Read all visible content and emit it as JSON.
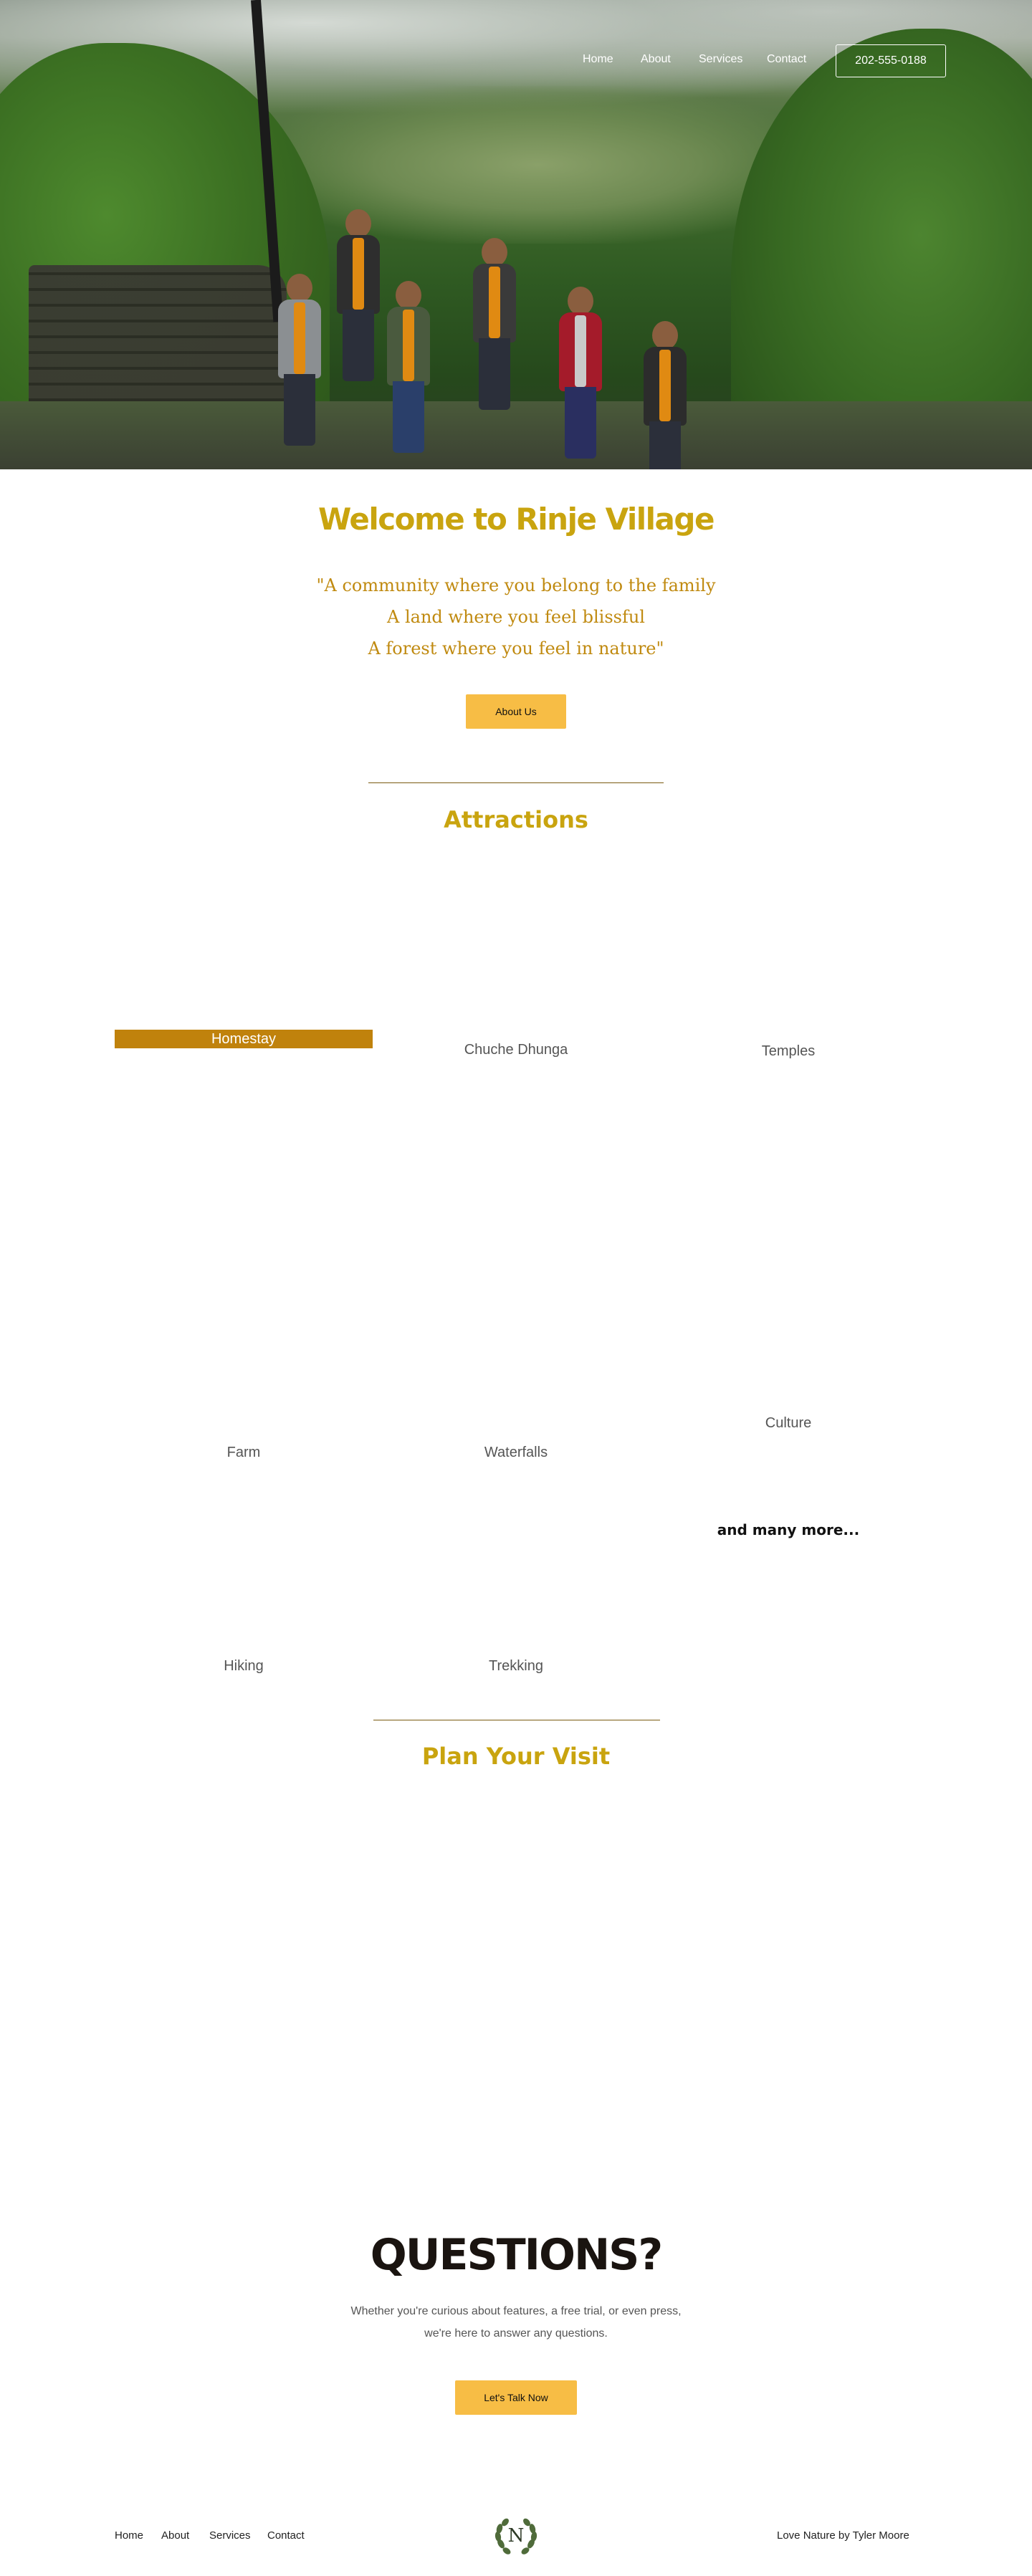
{
  "nav": {
    "links": [
      "Home",
      "About",
      "Services",
      "Contact"
    ],
    "phone": "202-555-0188"
  },
  "welcome": {
    "title": "Welcome to Rinje Village",
    "quote": [
      "\"A community where you belong to the family",
      "A land where you feel blissful",
      "A forest where you feel in nature\""
    ],
    "button": "About Us"
  },
  "attractions": {
    "title": "Attractions",
    "items": [
      "Homestay",
      "Chuche Dhunga",
      "Temples",
      "Farm",
      "Waterfalls",
      "Culture",
      "Hiking",
      "Trekking"
    ],
    "more": "and many more..."
  },
  "plan": {
    "title": "Plan Your Visit"
  },
  "questions": {
    "title": "QUESTIONS?",
    "text": "Whether you're curious about features, a free trial, or even press, we're here to answer any questions.",
    "button": "Let's Talk Now"
  },
  "footer": {
    "links": [
      "Home",
      "About",
      "Services",
      "Contact"
    ],
    "logo_letter": "N",
    "credit": "Love Nature by Tyler Moore"
  },
  "colors": {
    "gold_title": "#c9a40f",
    "quote": "#c08a10",
    "button": "#f7bd45",
    "active_label": "#c0820c"
  }
}
